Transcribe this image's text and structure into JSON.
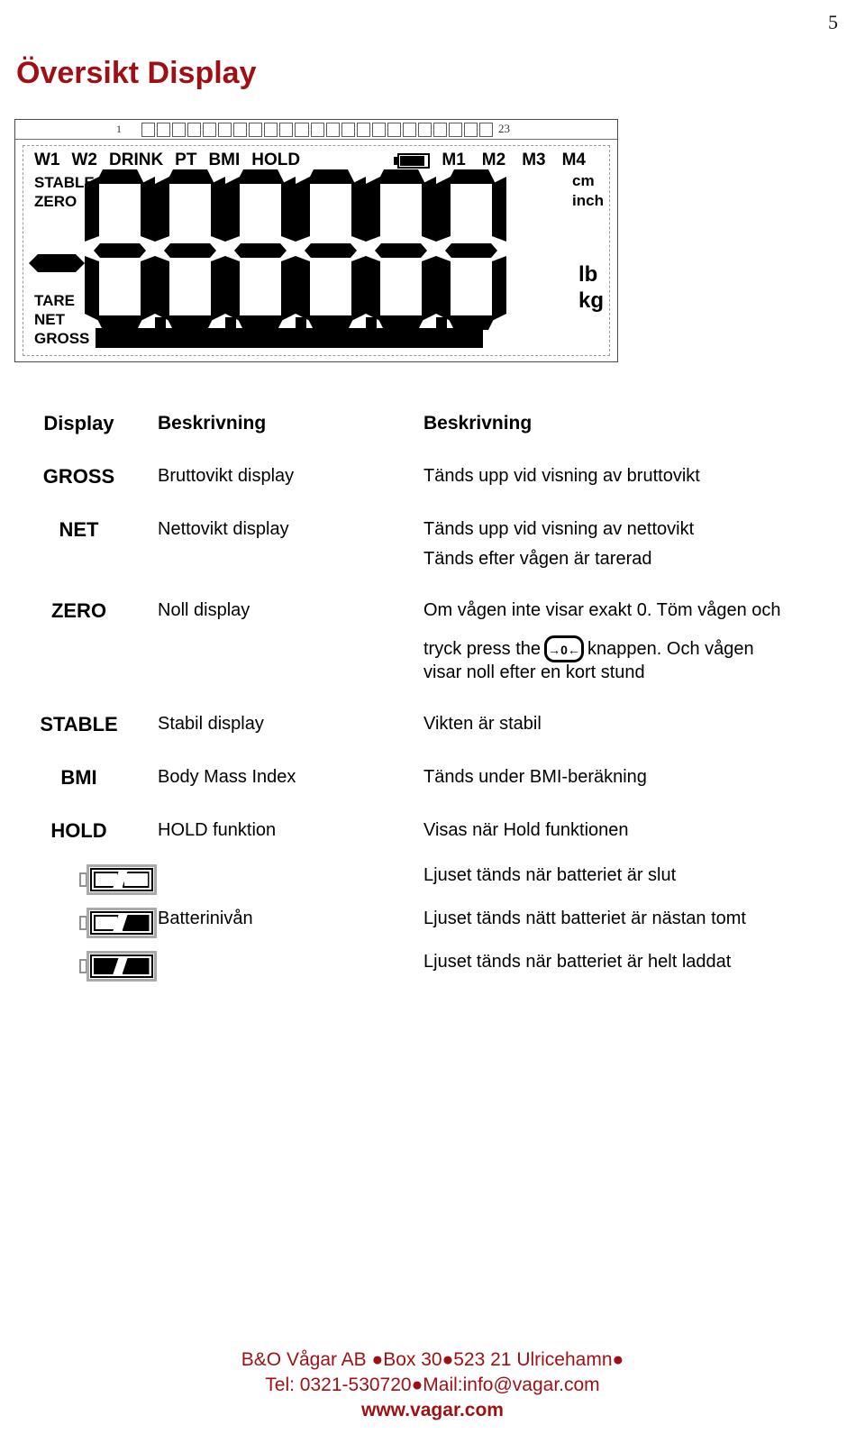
{
  "page": {
    "number": "5"
  },
  "title": "Översikt Display",
  "lcd": {
    "ruler": {
      "left_label": "1",
      "right_label": "23",
      "segment_count": 23
    },
    "annunciators_top": [
      "W1",
      "W2",
      "DRINK",
      "PT",
      "BMI",
      "HOLD"
    ],
    "battery_icon": "battery-icon",
    "memory_labels": [
      "M1",
      "M2",
      "M3",
      "M4"
    ],
    "left_top": [
      "STABLE",
      "ZERO"
    ],
    "left_bottom": [
      "TARE",
      "NET",
      "GROSS"
    ],
    "minus_indicator": "minus-sign",
    "right_top": [
      "cm",
      "inch"
    ],
    "right_bottom": [
      "lb",
      "kg"
    ],
    "digit_count": 6,
    "digit_value": "8",
    "decimal_points": 5
  },
  "table": {
    "headers": {
      "col1": "Display",
      "col2": "Beskrivning",
      "col3": "Beskrivning"
    },
    "rows": [
      {
        "display": "GROSS",
        "desc": "Bruttovikt display",
        "detail": [
          "Tänds upp vid visning av bruttovikt"
        ],
        "icon": null
      },
      {
        "display": "NET",
        "desc": "Nettovikt display",
        "detail": [
          "Tänds upp vid visning av nettovikt",
          "Tänds efter vågen är tarerad"
        ],
        "icon": null
      },
      {
        "display": "ZERO",
        "desc": "Noll  display",
        "detail": [
          "Om vågen inte visar exakt 0. Töm vågen och",
          "tryck press the",
          "knappen. Och vågen",
          "visar noll efter en kort stund"
        ],
        "icon": "zero-key",
        "zero_key_label": "→0←"
      },
      {
        "display": "STABLE",
        "desc": "Stabil display",
        "detail": [
          "Vikten är stabil"
        ],
        "icon": null
      },
      {
        "display": "BMI",
        "desc": "Body Mass Index",
        "detail": [
          "Tänds under BMI-beräkning"
        ],
        "icon": null
      },
      {
        "display": "HOLD",
        "desc": "HOLD funktion",
        "detail": [
          "Visas när Hold funktionen"
        ],
        "icon": null
      },
      {
        "display": "",
        "desc": "",
        "detail": [
          "Ljuset tänds när batteriet är slut"
        ],
        "icon": "battery-empty-icon"
      },
      {
        "display": "",
        "desc": "Batterinivån",
        "detail": [
          "Ljuset tänds nätt batteriet är nästan tomt"
        ],
        "icon": "battery-half-icon"
      },
      {
        "display": "",
        "desc": "",
        "detail": [
          "Ljuset tänds när batteriet är helt laddat"
        ],
        "icon": "battery-full-icon"
      }
    ]
  },
  "footer": {
    "line1": "B&O Vågar AB ●Box 30●523 21 Ulricehamn●",
    "line2": "Tel: 0321-530720●Mail:info@vagar.com",
    "line3": "www.vagar.com"
  },
  "colors": {
    "accent": "#9e1014",
    "text": "#000000",
    "lcd_border": "#4a4a4a"
  }
}
